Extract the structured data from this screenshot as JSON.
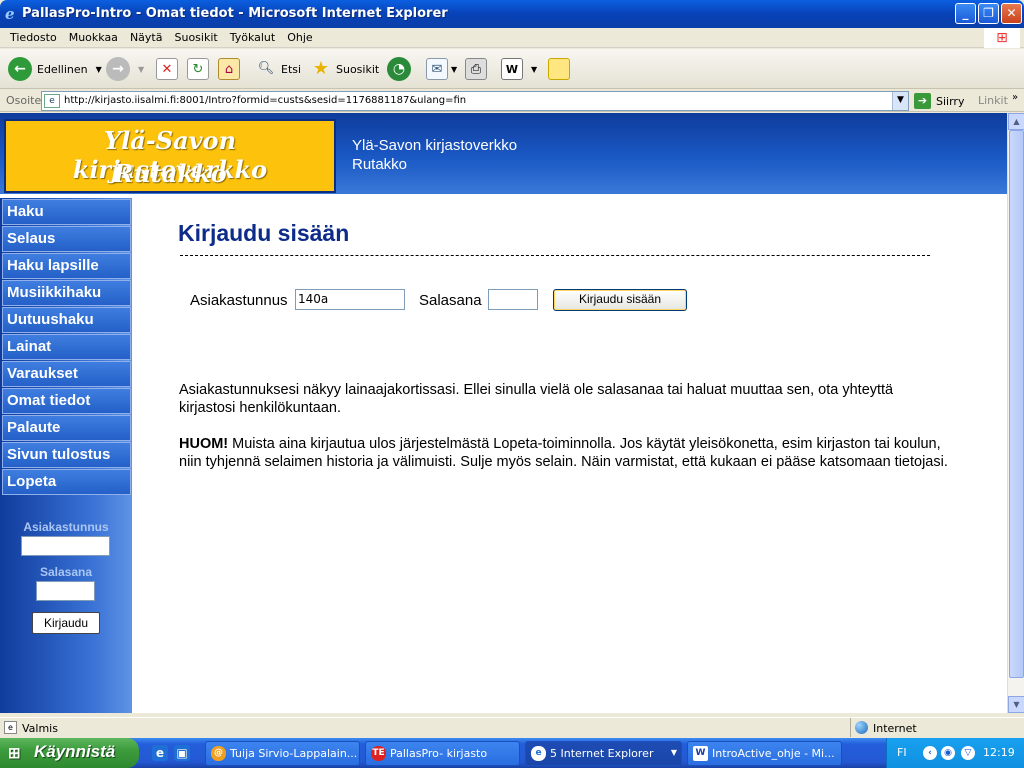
{
  "window": {
    "title": "PallasPro-Intro - Omat tiedot - Microsoft Internet Explorer"
  },
  "menu": [
    "Tiedosto",
    "Muokkaa",
    "Näytä",
    "Suosikit",
    "Työkalut",
    "Ohje"
  ],
  "toolbar": {
    "back_label": "Edellinen",
    "search_label": "Etsi",
    "favorites_label": "Suosikit"
  },
  "address": {
    "label": "Osoite",
    "url": "http://kirjasto.iisalmi.fi:8001/Intro?formid=custs&sesid=1176881187&ulang=fin",
    "go_label": "Siirry",
    "links_label": "Linkit"
  },
  "site": {
    "logo_line1": "Ylä-Savon kirjastoverkko",
    "logo_line2": "Rutakko",
    "header_line1": "Ylä-Savon kirjastoverkko",
    "header_line2": "Rutakko"
  },
  "nav": [
    "Haku",
    "Selaus",
    "Haku lapsille",
    "Musiikkihaku",
    "Uutuushaku",
    "Lainat",
    "Varaukset",
    "Omat tiedot",
    "Palaute",
    "Sivun tulostus",
    "Lopeta"
  ],
  "sidebar_login": {
    "user_label": "Asiakastunnus",
    "password_label": "Salasana",
    "button_label": "Kirjaudu"
  },
  "main": {
    "heading": "Kirjaudu sisään",
    "user_label": "Asiakastunnus",
    "user_value": "140a",
    "password_label": "Salasana",
    "submit_label": "Kirjaudu sisään",
    "info": "Asiakastunnuksesi näkyy lainaajakortissasi. Ellei sinulla vielä ole salasanaa tai haluat muuttaa sen, ota yhteyttä kirjastosi henkilökuntaan.",
    "warning_bold": "HUOM!",
    "warning": " Muista aina kirjautua ulos järjestelmästä Lopeta-toiminnolla. Jos käytät yleisökonetta, esim kirjaston tai koulun, niin tyhjennä selaimen historia ja välimuisti. Sulje myös selain. Näin varmistat, että kukaan ei pääse katsomaan tietojasi."
  },
  "status": {
    "text": "Valmis",
    "zone": "Internet"
  },
  "taskbar": {
    "start": "Käynnistä",
    "tasks": [
      "Tuija Sirvio-Lappalain...",
      "PallasPro- kirjasto",
      "5 Internet Explorer",
      "IntroActive_ohje - Mi..."
    ],
    "lang": "FI",
    "clock": "12:19"
  },
  "colors": {
    "header_blue": "#1a58c4",
    "logo_yellow": "#fcc20c",
    "heading_navy": "#0c2c88"
  }
}
